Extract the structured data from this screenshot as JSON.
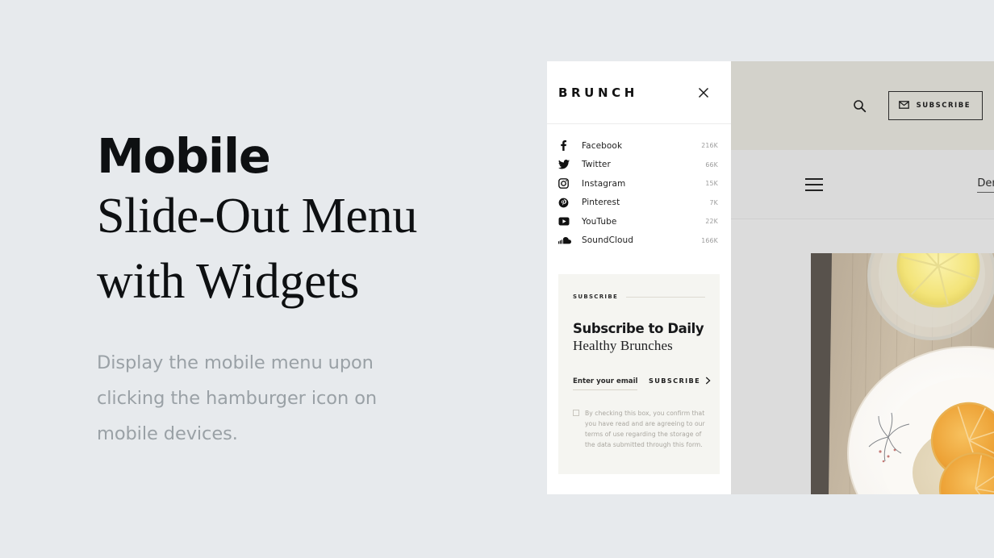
{
  "promo": {
    "title_sans": "Mobile",
    "title_serif_line1": "Slide-Out Menu",
    "title_serif_line2": "with Widgets",
    "subtitle": "Display the mobile menu upon clicking the hamburger icon on mobile devices."
  },
  "site": {
    "topbar": {
      "search_icon": "search-icon",
      "subscribe_label": "SUBSCRIBE",
      "subscribe_icon": "envelope-icon"
    },
    "navbar": {
      "menu_icon": "hamburger-icon",
      "demo_label": "Demo"
    }
  },
  "drawer": {
    "brand": "BRUNCH",
    "close_icon": "close-icon",
    "social": [
      {
        "icon": "facebook-icon",
        "name": "Facebook",
        "count": "216K"
      },
      {
        "icon": "twitter-icon",
        "name": "Twitter",
        "count": "66K"
      },
      {
        "icon": "instagram-icon",
        "name": "Instagram",
        "count": "15K"
      },
      {
        "icon": "pinterest-icon",
        "name": "Pinterest",
        "count": "7K"
      },
      {
        "icon": "youtube-icon",
        "name": "YouTube",
        "count": "22K"
      },
      {
        "icon": "soundcloud-icon",
        "name": "SoundCloud",
        "count": "166K"
      }
    ],
    "widget": {
      "tag": "SUBSCRIBE",
      "heading_bold": "Subscribe to Daily",
      "heading_serif": "Healthy Brunches",
      "email_placeholder": "Enter your email",
      "submit_label": "SUBSCRIBE",
      "submit_icon": "chevron-right-icon",
      "consent_text": "By checking this box, you confirm that you have read and are agreeing to our terms of use regarding the storage of the data submitted through this form."
    }
  },
  "colors": {
    "page_background": "#e7eaed",
    "drawer_background": "#ffffff",
    "widget_background": "#f5f5f1",
    "topbar_background": "#d3d2cb",
    "navbar_background": "#dadada",
    "body_background": "#dcdcdc",
    "text_primary": "#111315",
    "text_muted": "#9aa1a6"
  }
}
